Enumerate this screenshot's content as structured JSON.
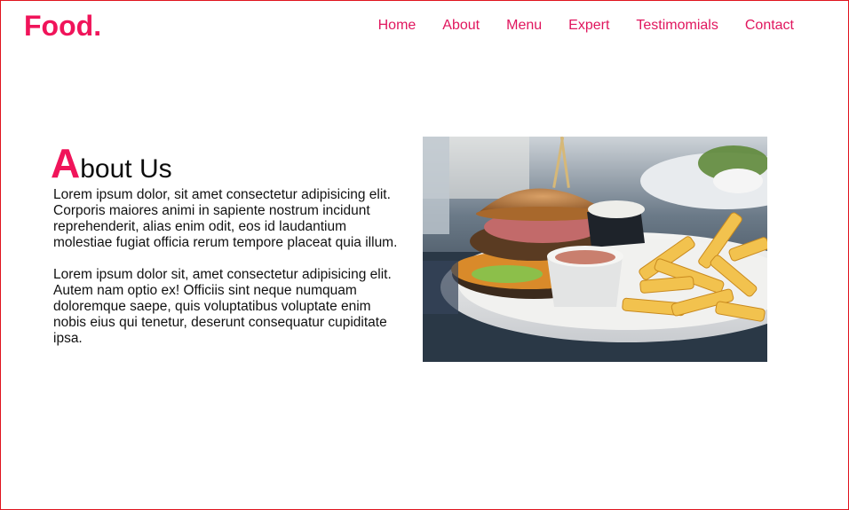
{
  "header": {
    "logo": "Food."
  },
  "nav": {
    "items": [
      {
        "label": "Home"
      },
      {
        "label": "About"
      },
      {
        "label": "Menu"
      },
      {
        "label": "Expert"
      },
      {
        "label": "Testimomials"
      },
      {
        "label": "Contact"
      }
    ]
  },
  "about": {
    "title_first_letter": "A",
    "title_rest": "bout Us",
    "paragraphs": [
      "Lorem ipsum dolor, sit amet consectetur adipisicing elit. Corporis maiores animi in sapiente nostrum incidunt reprehenderit, alias enim odit, eos id laudantium molestiae fugiat officia rerum tempore placeat quia illum.",
      "Lorem ipsum dolor sit, amet consectetur adipisicing elit. Autem nam optio ex! Officiis sint neque numquam doloremque saepe, quis voluptatibus voluptate enim nobis eius qui tenetur, deserunt consequatur cupiditate ipsa."
    ]
  },
  "colors": {
    "accent": "#f0145a",
    "border": "#e0141e",
    "text": "#111111",
    "background": "#ffffff"
  }
}
